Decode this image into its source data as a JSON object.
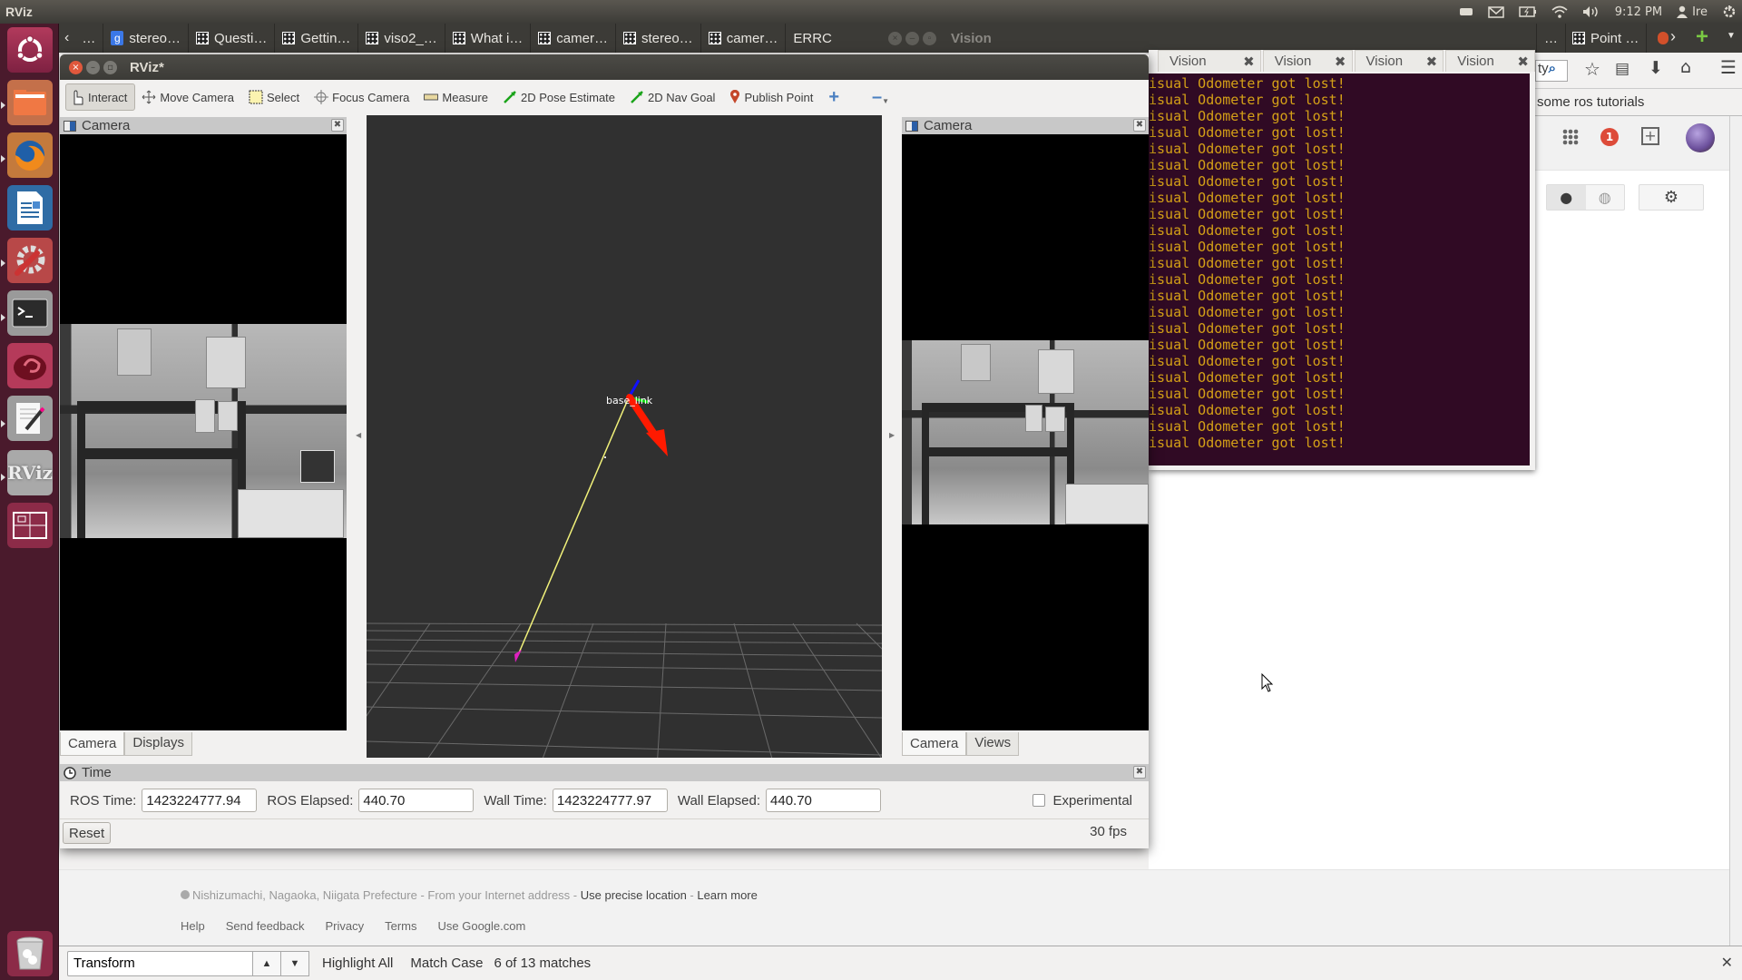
{
  "top_panel": {
    "app_title": "RViz",
    "clock": "9:12 PM",
    "user": "Ire",
    "indicators": [
      "keyboard-icon",
      "mail-icon",
      "battery-icon",
      "wifi-icon",
      "volume-icon"
    ]
  },
  "launcher": {
    "items": [
      {
        "name": "dash-home",
        "icon": "ubuntu-logo-icon"
      },
      {
        "name": "files",
        "icon": "folder-icon"
      },
      {
        "name": "firefox",
        "icon": "firefox-icon"
      },
      {
        "name": "libreoffice-writer",
        "icon": "writer-icon"
      },
      {
        "name": "system-settings",
        "icon": "settings-wrench-icon"
      },
      {
        "name": "terminal",
        "icon": "terminal-icon"
      },
      {
        "name": "app-red",
        "icon": "swirl-icon"
      },
      {
        "name": "text-editor",
        "icon": "text-editor-icon"
      },
      {
        "name": "rviz",
        "icon": "rviz-icon",
        "label": "RViz"
      },
      {
        "name": "workspace-switcher",
        "icon": "workspace-icon"
      },
      {
        "name": "trash",
        "icon": "trash-icon"
      }
    ]
  },
  "browser": {
    "tabs": [
      {
        "label": "…",
        "favicon": "grid"
      },
      {
        "label": "stereo…",
        "favicon": "google"
      },
      {
        "label": "Questi…",
        "favicon": "grid"
      },
      {
        "label": "Gettin…",
        "favicon": "grid"
      },
      {
        "label": "viso2_…",
        "favicon": "grid"
      },
      {
        "label": "What i…",
        "favicon": "grid"
      },
      {
        "label": "camer…",
        "favicon": "grid"
      },
      {
        "label": "stereo…",
        "favicon": "grid"
      },
      {
        "label": "camer…",
        "favicon": "grid"
      },
      {
        "label": "ERRC",
        "favicon": "none"
      }
    ],
    "tabs_right": [
      {
        "label": "…",
        "favicon": "none"
      },
      {
        "label": "Point …",
        "favicon": "grid"
      }
    ],
    "search_text": "ty",
    "bookmark_text": "some ros tutorials",
    "notification_count": "1",
    "footer": {
      "location": "Nishizumachi, Nagaoka, Niigata Prefecture",
      "location_source": " - From your Internet address - ",
      "use_precise": "Use precise location",
      "sep": " - ",
      "learn_more": "Learn more",
      "links": [
        "Help",
        "Send feedback",
        "Privacy",
        "Terms",
        "Use Google.com"
      ]
    },
    "findbar": {
      "query": "Transform",
      "highlight_all": "Highlight All",
      "match_case": "Match Case",
      "status": "6 of 13 matches"
    }
  },
  "terminal": {
    "window_title": "Vision",
    "tabs": [
      "Vision",
      "Vision",
      "Vision",
      "Vision"
    ],
    "lines": [
      "isual Odometer got lost!",
      "isual Odometer got lost!",
      "isual Odometer got lost!",
      "isual Odometer got lost!",
      "isual Odometer got lost!",
      "isual Odometer got lost!",
      "isual Odometer got lost!",
      "isual Odometer got lost!",
      "isual Odometer got lost!",
      "isual Odometer got lost!",
      "isual Odometer got lost!",
      "isual Odometer got lost!",
      "isual Odometer got lost!",
      "isual Odometer got lost!",
      "isual Odometer got lost!",
      "isual Odometer got lost!",
      "isual Odometer got lost!",
      "isual Odometer got lost!",
      "isual Odometer got lost!",
      "isual Odometer got lost!",
      "isual Odometer got lost!",
      "isual Odometer got lost!",
      "isual Odometer got lost!"
    ],
    "text_color": "#d4a017",
    "bg_color": "#300a24"
  },
  "rviz": {
    "title": "RViz*",
    "toolbar": [
      {
        "label": "Interact",
        "icon": "hand-pointer-icon",
        "active": true
      },
      {
        "label": "Move Camera",
        "icon": "move-camera-icon"
      },
      {
        "label": "Select",
        "icon": "select-rect-icon"
      },
      {
        "label": "Focus Camera",
        "icon": "focus-crosshair-icon"
      },
      {
        "label": "Measure",
        "icon": "ruler-icon"
      },
      {
        "label": "2D Pose Estimate",
        "icon": "green-arrow-icon"
      },
      {
        "label": "2D Nav Goal",
        "icon": "green-arrow-icon"
      },
      {
        "label": "Publish Point",
        "icon": "map-pin-icon"
      }
    ],
    "left_panel": {
      "title": "Camera",
      "tabs": [
        "Camera",
        "Displays"
      ],
      "selected_tab": "Camera"
    },
    "right_panel": {
      "title": "Camera",
      "tabs": [
        "Camera",
        "Views"
      ],
      "selected_tab": "Camera"
    },
    "view3d": {
      "frame_label": "base_link",
      "bg_color": "#303030"
    },
    "time": {
      "title": "Time",
      "ros_time_label": "ROS Time:",
      "ros_time": "1423224777.94",
      "ros_elapsed_label": "ROS Elapsed:",
      "ros_elapsed": "440.70",
      "wall_time_label": "Wall Time:",
      "wall_time": "1423224777.97",
      "wall_elapsed_label": "Wall Elapsed:",
      "wall_elapsed": "440.70",
      "experimental_label": "Experimental",
      "experimental_checked": false,
      "reset_label": "Reset",
      "fps": "30 fps"
    }
  }
}
